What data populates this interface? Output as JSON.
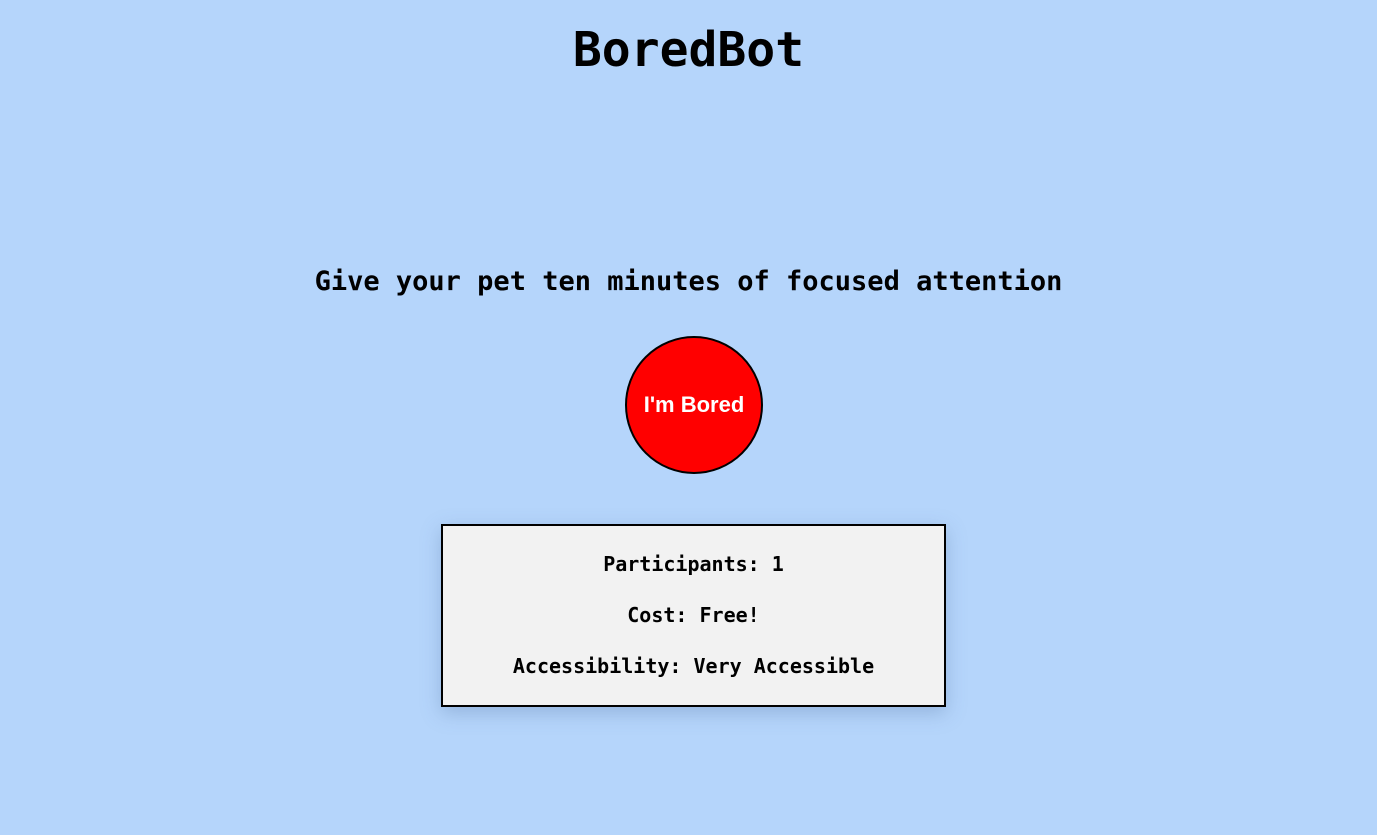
{
  "app": {
    "title": "BoredBot"
  },
  "activity": {
    "text": "Give your pet ten minutes of focused attention"
  },
  "button": {
    "label": "I'm Bored"
  },
  "details": {
    "participants": "Participants: 1",
    "cost": "Cost: Free!",
    "accessibility": "Accessibility: Very Accessible"
  },
  "colors": {
    "background": "#b5d5fb",
    "button": "#ff0000",
    "card": "#f2f2f2"
  }
}
